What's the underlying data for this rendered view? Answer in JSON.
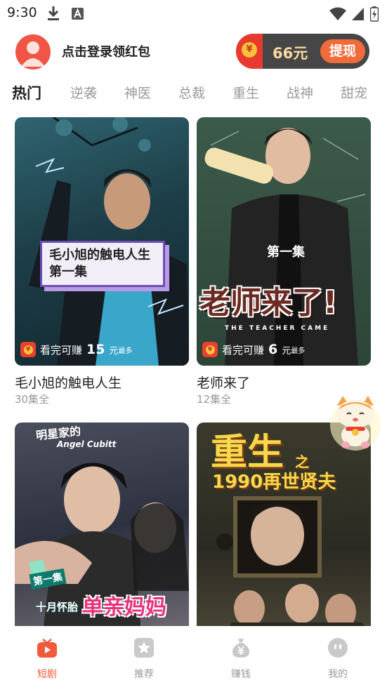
{
  "status_bar": {
    "time": "9:30"
  },
  "header": {
    "login_text": "点击登录领红包",
    "coin_amount": "66元",
    "withdraw_label": "提现",
    "coin_symbol": "¥"
  },
  "tabs": [
    "热门",
    "逆袭",
    "神医",
    "总裁",
    "重生",
    "战神",
    "甜宠"
  ],
  "dramas": [
    {
      "title": "毛小旭的触电人生",
      "episodes": "30集全",
      "poster_caption": "毛小旭的触电人生第一集",
      "earn": {
        "prefix": "看完可赚",
        "amount": "15",
        "unit": "元",
        "suffix": "最多"
      }
    },
    {
      "title": "老师来了",
      "episodes": "12集全",
      "poster_episode": "第一集",
      "poster_title": "老师来了!",
      "poster_subtitle": "THE TEACHER CAME",
      "earn": {
        "prefix": "看完可赚",
        "amount": "6",
        "unit": "元",
        "suffix": "最多"
      }
    },
    {
      "title": "",
      "episodes": "",
      "poster_episode": "第一集",
      "poster_subtitle": "十月怀胎",
      "poster_title": "单亲妈妈",
      "poster_top": "明星家的",
      "poster_english": "Angel Cubitt"
    },
    {
      "title": "",
      "episodes": "",
      "poster_title_1": "重生",
      "poster_title_2": "之",
      "poster_title_3": "1990再世贤夫"
    }
  ],
  "bottom_nav": [
    {
      "label": "短剧",
      "icon": "tv-icon",
      "active": true
    },
    {
      "label": "推荐",
      "icon": "star-icon",
      "active": false
    },
    {
      "label": "赚钱",
      "icon": "money-bag-icon",
      "active": false
    },
    {
      "label": "我的",
      "icon": "profile-face-icon",
      "active": false
    }
  ],
  "colors": {
    "accent": "#f05a3a",
    "pill_bg": "#464646",
    "pill_text": "#f8d9a0",
    "withdraw_bg": "#f26b3a"
  }
}
